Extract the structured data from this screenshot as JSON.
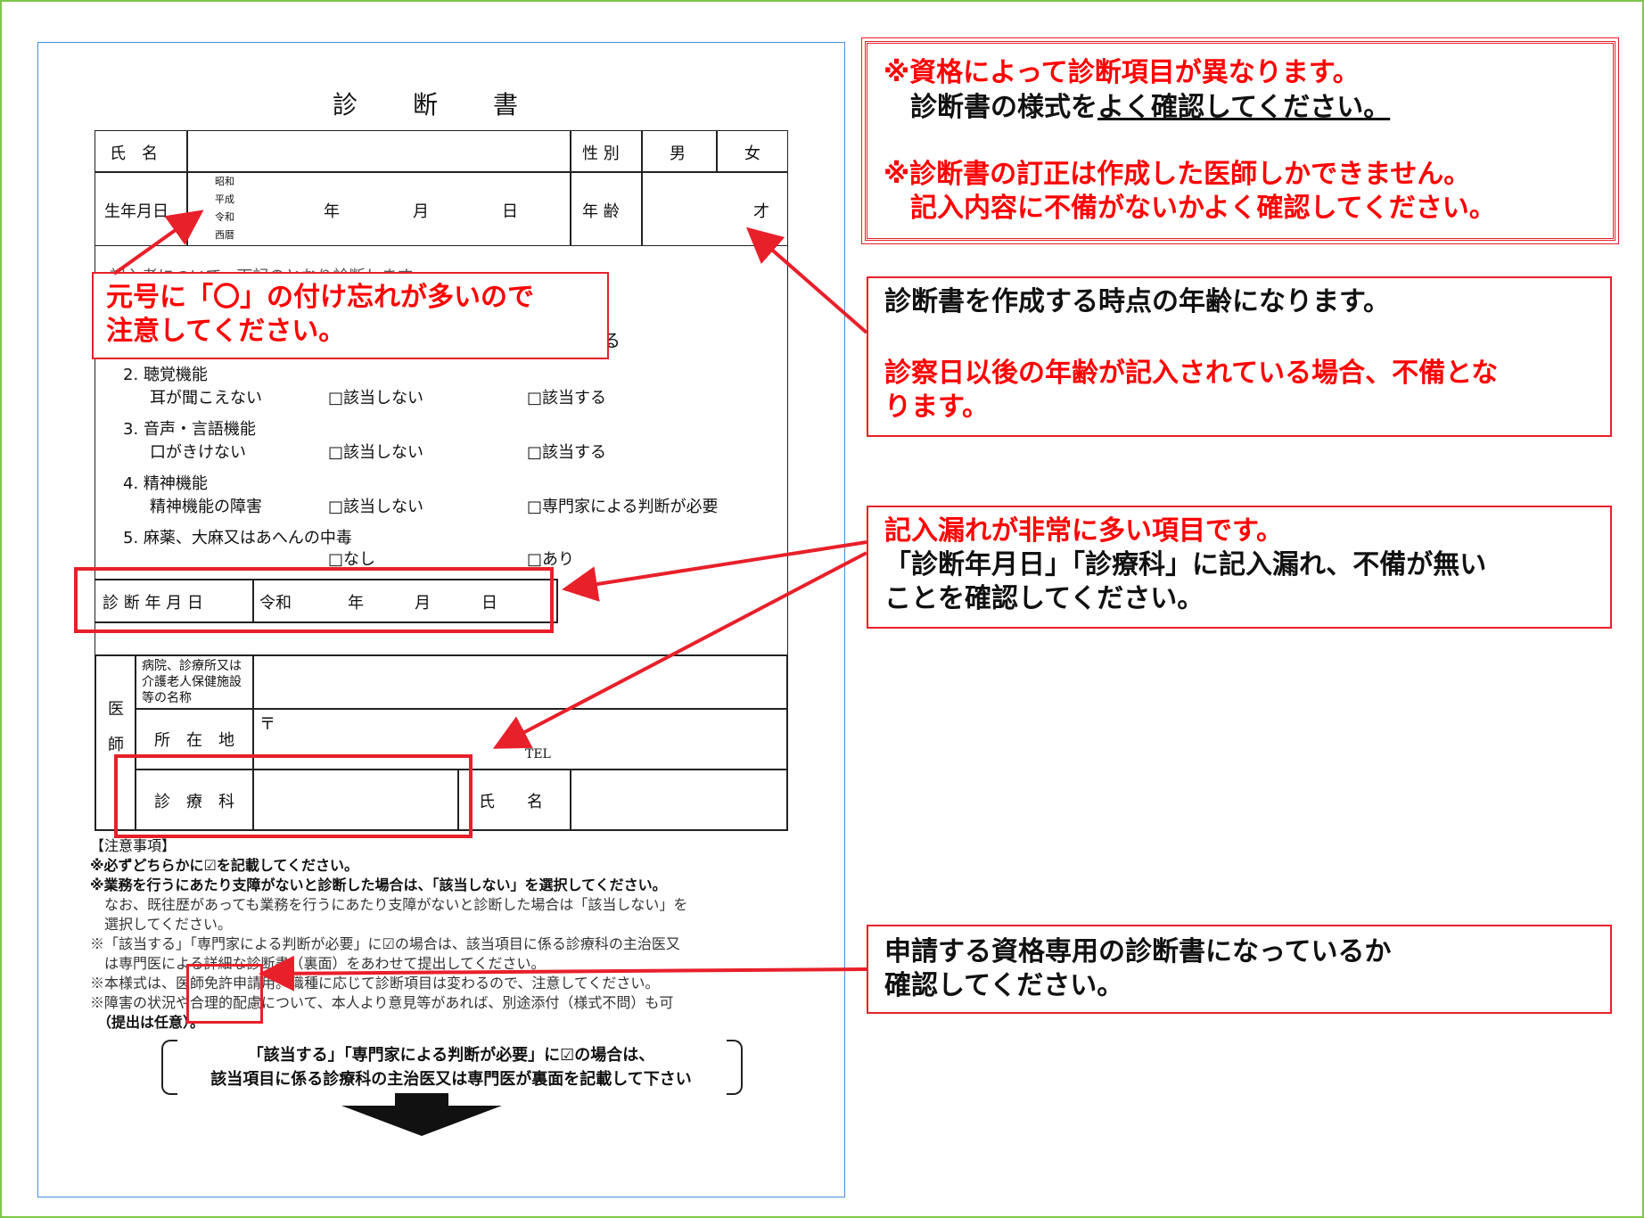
{
  "form": {
    "title": "診　　断　　書",
    "name_label": "氏　名",
    "sex_label": "性 別",
    "male": "男",
    "female": "女",
    "birth_label": "生年月日",
    "eras": [
      "昭和",
      "平成",
      "令和",
      "西暦"
    ],
    "year": "年",
    "month": "月",
    "day": "日",
    "age_label": "年 齢",
    "age_unit": "才",
    "partial_line": "記入者について、下記のとおり診断します。",
    "partial_ru": "る",
    "items": [
      {
        "title": "2. 聴覚機能",
        "sub": "耳が聞こえない",
        "opt1": "□該当しない",
        "opt2": "□該当する"
      },
      {
        "title": "3. 音声・言語機能",
        "sub": "口がきけない",
        "opt1": "□該当しない",
        "opt2": "□該当する"
      },
      {
        "title": "4. 精神機能",
        "sub": "精神機能の障害",
        "opt1": "□該当しない",
        "opt2": "□専門家による判断が必要"
      },
      {
        "title": "5. 麻薬、大麻又はあへんの中毒",
        "sub": "",
        "opt1": "□なし",
        "opt2": "□あり"
      }
    ],
    "diag_date_label": "診 断 年 月 日",
    "diag_era": "令和",
    "doctor_label_1": "医",
    "doctor_label_2": "師",
    "hospital_label": "病院、診療所又は介護老人保健施設等の名称",
    "address_label": "所　在　地",
    "postal_mark": "〒",
    "tel_label": "TEL",
    "dept_label": "診　療　科",
    "doctor_name_label": "氏　　名",
    "notes_heading": "【注意事項】",
    "notes": [
      "※必ずどちらかに☑を記載してください。",
      "※業務を行うにあたり支障がないと診断した場合は、「該当しない」を選択してください。",
      "　なお、既往歴があっても業務を行うにあたり支障がないと診断した場合は「該当しない」を",
      "　選択してください。",
      "※「該当する」「専門家による判断が必要」に☑の場合は、該当項目に係る診療科の主治医又",
      "　は専門医による詳細な診断書（裏面）をあわせて提出してください。",
      "※本様式は、医師免許申請用。職種に応じて診断項目は変わるので、注意してください。",
      "※障害の状況や合理的配慮について、本人より意見等があれば、別途添付（様式不問）も可",
      "　（提出は任意）。"
    ],
    "bracket_line1": "「該当する」「専門家による判断が必要」に☑の場合は、",
    "bracket_line2": "該当項目に係る診療科の主治医又は専門医が裏面を記載して下さい"
  },
  "callouts": {
    "top_red_1": "※資格によって診断項目が異なります。",
    "top_black_1a": "　診断書の様式を",
    "top_black_1b": "よく確認してください。",
    "top_red_2": "※診断書の訂正は作成した医師しかできません。",
    "top_red_3": "　記入内容に不備がないかよく確認してください。",
    "era_1": "元号に「〇」の付け忘れが多いので",
    "era_2": "注意してください。",
    "age_1": "診断書を作成する時点の年齢になります。",
    "age_2": "診察日以後の年齢が記入されている場合、不備とな",
    "age_3": "ります。",
    "omit_1": "記入漏れが非常に多い項目です。",
    "omit_2": "「診断年月日」「診療科」に記入漏れ、不備が無い",
    "omit_3": "ことを確認してください。",
    "qual_1": "申請する資格専用の診断書になっているか",
    "qual_2": "確認してください。"
  },
  "colors": {
    "border_green": "#7dc54a",
    "doc_border": "#4a8fd6",
    "accent_red": "#e8202a",
    "text_red": "#ff0000"
  }
}
